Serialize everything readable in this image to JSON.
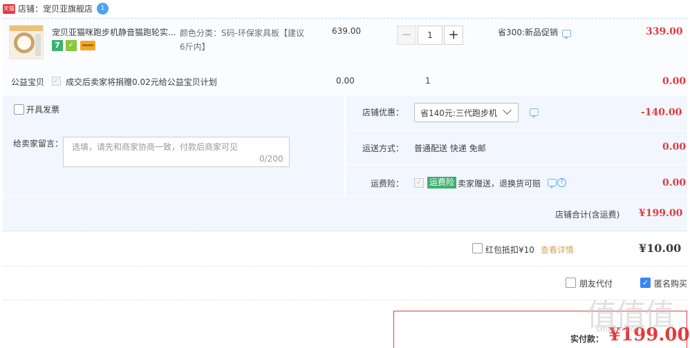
{
  "shop": {
    "badge": "天猫",
    "label": "店铺：宠贝亚旗舰店",
    "ww_badge": "1"
  },
  "item": {
    "title": "宠贝亚猫咪跑步机静音猫跑轮实...",
    "badge_seven": "7",
    "sku": "颜色分类：S码-环保家具板【建议6斤内】",
    "price": "639.00",
    "qty": "1",
    "qty_minus": "−",
    "qty_plus": "+",
    "promo": "省300:新品促销",
    "subtotal": "339.00"
  },
  "charity": {
    "label": "公益宝贝",
    "text": "成交后卖家将捐赠0.02元给公益宝贝计划",
    "price": "0.00",
    "qty": "1",
    "subtotal": "0.00"
  },
  "options": {
    "invoice_label": "开具发票",
    "memo_label": "给卖家留言：",
    "memo_placeholder": "选填，请先和商家协商一致，付款后商家可见",
    "memo_count": "0/200",
    "shop_discount_label": "店铺优惠：",
    "shop_discount_selected": "省140元:三代跑步机",
    "shop_discount_value": "-140.00",
    "shipping_label": "运送方式：",
    "shipping_value": "普通配送 快递 免邮",
    "shipping_fee": "0.00",
    "insurance_label": "运费险：",
    "insurance_tag": "运费险",
    "insurance_text": "卖家赠送，退换货可赔",
    "insurance_fee": "0.00"
  },
  "totals": {
    "shop_total_label": "店铺合计(含运费)",
    "shop_total_value": "¥199.00",
    "redpacket_label": "红包抵扣¥10",
    "redpacket_link": "查看详情",
    "redpacket_value": "¥10.00",
    "friend_pay_label": "朋友代付",
    "anonymous_label": "匿名购买",
    "pay_label": "实付款：",
    "pay_value": "¥199.00"
  },
  "watermark": {
    "text": "值值值",
    "url": "smzdm.com"
  },
  "colors": {
    "price_red": "#e4393c",
    "option_bg": "#f2f7ff",
    "checkbox_blue": "#3b86f6",
    "insurance_green": "#3eaf6e"
  }
}
